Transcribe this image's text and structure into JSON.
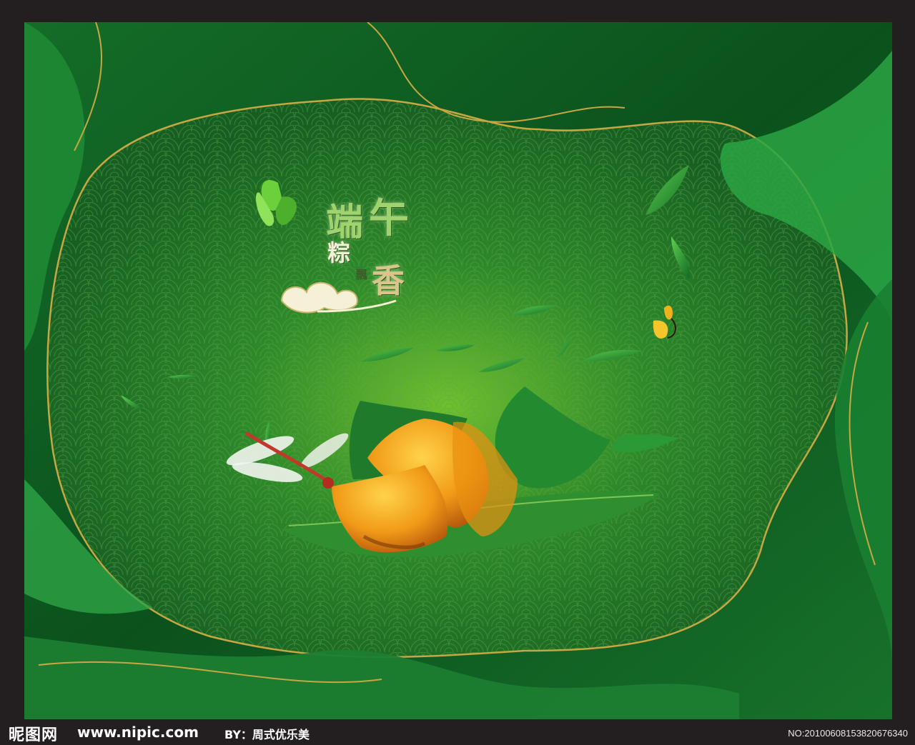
{
  "poster": {
    "title_chars": [
      "端",
      "午",
      "粽",
      "香",
      "飄"
    ],
    "colors": {
      "frame": "#231e1f",
      "deep_green": "#0d4a1d",
      "bright_green": "#3fae3a",
      "gold_line": "#b49a3a",
      "pattern_line": "#58a04a",
      "zongzi_yellow": "#f0a21c"
    },
    "decorations": [
      "butterfly-green",
      "butterfly-yellow",
      "dragonfly",
      "zongzi",
      "bamboo-leaves",
      "auspicious-cloud"
    ]
  },
  "footer": {
    "logo_text": "昵图网",
    "site_text": "www.nipic.com",
    "by_text": "BY：周式优乐美",
    "number_text": "NO:20100608153820676340"
  }
}
